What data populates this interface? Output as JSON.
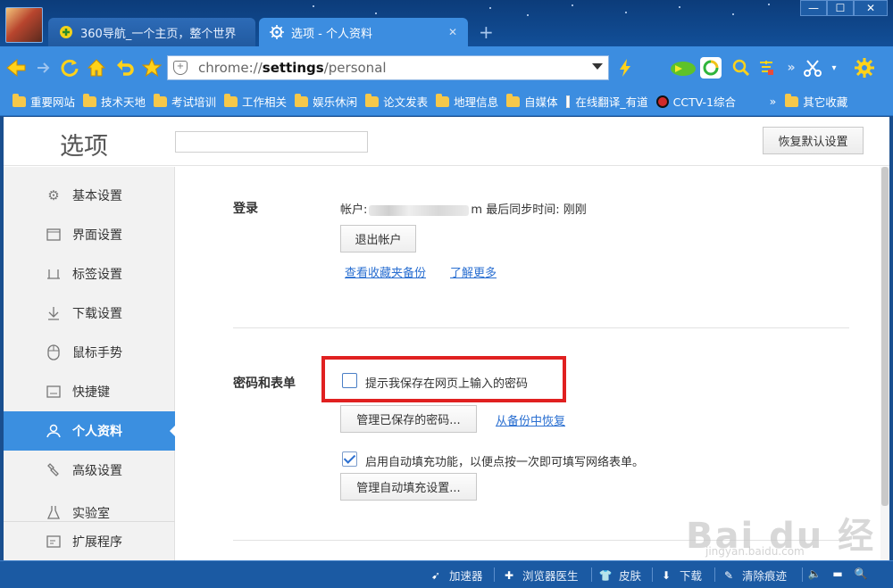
{
  "tabs": [
    {
      "label": "360导航_一个主页，整个世界",
      "icon": "plus-circle-icon"
    },
    {
      "label": "选项 - 个人资料",
      "icon": "gear-icon"
    }
  ],
  "window_controls": [
    "—",
    "☐",
    "✕"
  ],
  "address_bar": {
    "scheme": "chrome://",
    "host": "settings",
    "path": "/personal"
  },
  "bookmarks": [
    {
      "label": "重要网站",
      "type": "folder"
    },
    {
      "label": "技术天地",
      "type": "folder"
    },
    {
      "label": "考试培训",
      "type": "folder"
    },
    {
      "label": "工作相关",
      "type": "folder"
    },
    {
      "label": "娱乐休闲",
      "type": "folder"
    },
    {
      "label": "论文发表",
      "type": "folder"
    },
    {
      "label": "地理信息",
      "type": "folder"
    },
    {
      "label": "自媒体",
      "type": "folder"
    },
    {
      "label": "在线翻译_有道",
      "type": "page"
    },
    {
      "label": "CCTV-1综合",
      "type": "cctv"
    }
  ],
  "bookmarks_more": "»",
  "bookmarks_other": "其它收藏",
  "header": {
    "title": "选项",
    "restore_button": "恢复默认设置"
  },
  "sidebar": {
    "items": [
      {
        "label": "基本设置",
        "icon": "gear-icon"
      },
      {
        "label": "界面设置",
        "icon": "window-icon"
      },
      {
        "label": "标签设置",
        "icon": "tab-icon"
      },
      {
        "label": "下载设置",
        "icon": "download-icon"
      },
      {
        "label": "鼠标手势",
        "icon": "mouse-icon"
      },
      {
        "label": "快捷键",
        "icon": "keyboard-icon"
      },
      {
        "label": "个人资料",
        "icon": "user-icon",
        "active": true
      },
      {
        "label": "高级设置",
        "icon": "wrench-icon"
      },
      {
        "label": "实验室",
        "icon": "flask-icon"
      }
    ],
    "extensions": {
      "label": "扩展程序",
      "icon": "extension-icon"
    }
  },
  "login": {
    "title": "登录",
    "account_label": "帐户:",
    "account_value_tail": "m",
    "sync_label": "最后同步时间:",
    "sync_value": "刚刚",
    "logout_button": "退出帐户",
    "link_backup": "查看收藏夹备份",
    "link_more": "了解更多"
  },
  "passwords": {
    "title": "密码和表单",
    "save_pw_checkbox": "提示我保存在网页上输入的密码",
    "save_pw_checked": false,
    "manage_pw_button": "管理已保存的密码...",
    "restore_link": "从备份中恢复",
    "autofill_checkbox": "启用自动填充功能，以便点按一次即可填写网络表单。",
    "autofill_checked": true,
    "autofill_button": "管理自动填充设置..."
  },
  "statusbar": {
    "accelerator": "加速器",
    "doctor": "浏览器医生",
    "skin": "皮肤",
    "download": "下载",
    "clear": "清除痕迹"
  },
  "watermark": {
    "main": "Bai du 经验",
    "sub": "jingyan.baidu.com"
  },
  "colors": {
    "accent": "#3b8fe0",
    "highlight": "#e02020",
    "titlebar": "#0c3c7a",
    "link": "#2a6fd1"
  }
}
